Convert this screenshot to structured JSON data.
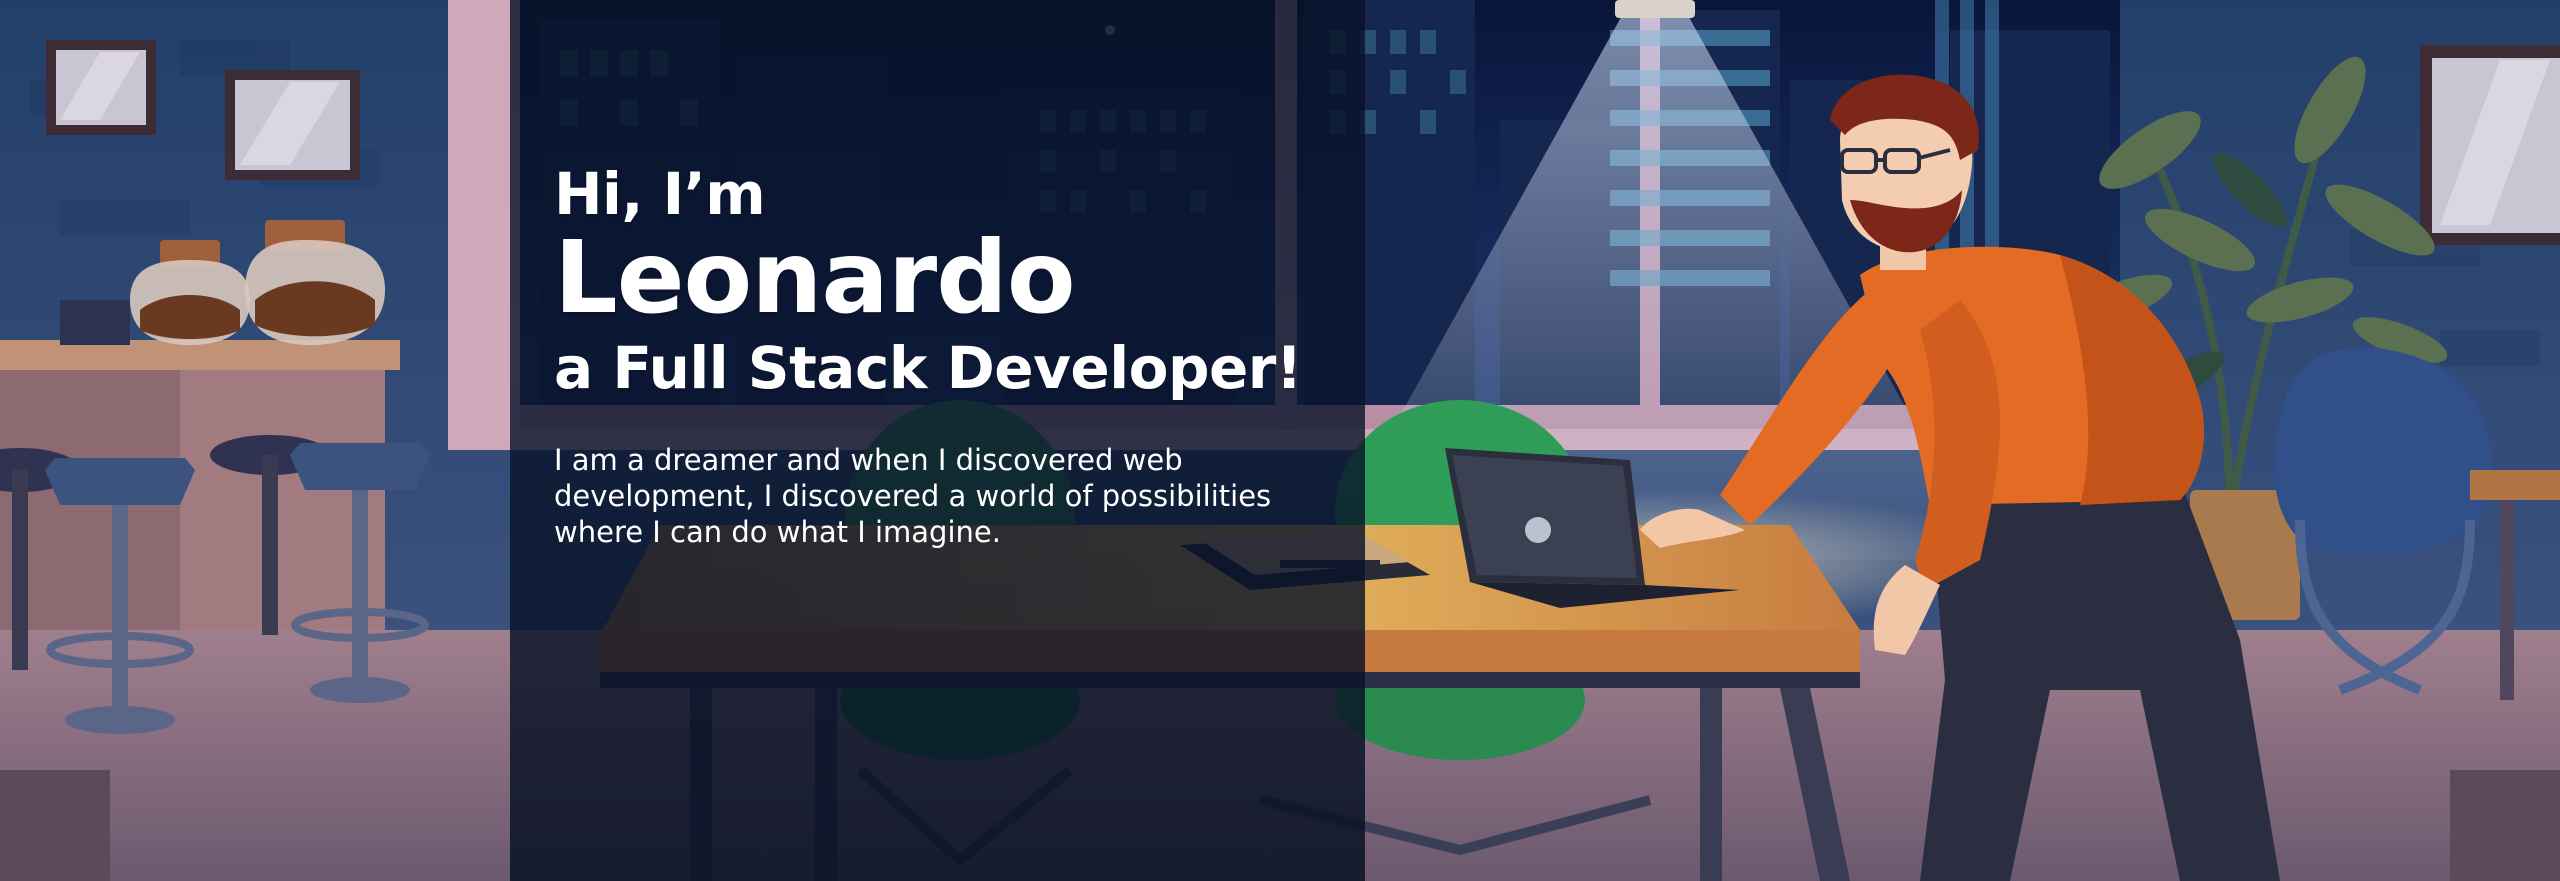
{
  "hero": {
    "greeting": "Hi, I’m",
    "name": "Leonardo",
    "role": "a Full Stack Developer!",
    "bio": "I am a dreamer and when I discovered web development, I discovered a world of possibilities where I can do what I imagine."
  },
  "palette": {
    "wall": "#214270",
    "night_sky": "#0d1b3d",
    "window_frame": "#c8a6b8",
    "desk_top": "#c67a3f",
    "sweater": "#e46b23",
    "hair": "#7d2718",
    "chair": "#2f9c57",
    "overlay": "#09142c",
    "text": "#ffffff"
  }
}
